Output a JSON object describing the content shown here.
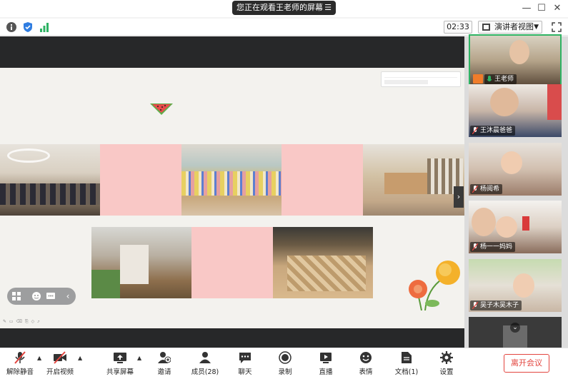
{
  "title_bar": {
    "share_status": "您正在观看王老师的屏幕",
    "menu_icon": "menu-icon",
    "window_controls": [
      "minimize-icon",
      "maximize-icon",
      "close-icon"
    ]
  },
  "toolbar": {
    "left_icons": [
      "info-icon",
      "shield-icon",
      "signal-icon"
    ],
    "timer": "02:33",
    "view_mode": "演讲者视图",
    "right_icon": "fullscreen-icon"
  },
  "participants": [
    {
      "name": "王老师",
      "host": true,
      "active": true
    },
    {
      "name": "王沐晨爸爸",
      "host": false,
      "active": false
    },
    {
      "name": "杨阅希",
      "host": false,
      "active": false
    },
    {
      "name": "杨一一妈妈",
      "host": false,
      "active": false
    },
    {
      "name": "吴子木吴木子",
      "host": false,
      "active": false
    },
    {
      "name": "",
      "host": false,
      "active": false
    }
  ],
  "bottom_bar": {
    "buttons": [
      {
        "label": "解除静音",
        "icon": "mic-muted-icon"
      },
      {
        "label": "开启视频",
        "icon": "video-off-icon"
      },
      {
        "label": "共享屏幕",
        "icon": "share-screen-icon"
      },
      {
        "label": "邀请",
        "icon": "invite-icon"
      },
      {
        "label": "成员(28)",
        "icon": "members-icon"
      },
      {
        "label": "聊天",
        "icon": "chat-icon"
      },
      {
        "label": "录制",
        "icon": "record-icon"
      },
      {
        "label": "直播",
        "icon": "live-icon"
      },
      {
        "label": "表情",
        "icon": "emoji-icon"
      },
      {
        "label": "文档(1)",
        "icon": "document-icon"
      },
      {
        "label": "设置",
        "icon": "settings-icon"
      }
    ],
    "leave_label": "离开会议"
  },
  "colors": {
    "accent_green": "#2fb364",
    "leave_red": "#e3453f",
    "slide_pink": "#f9c8c6",
    "slide_bg": "#f3f2ee"
  }
}
